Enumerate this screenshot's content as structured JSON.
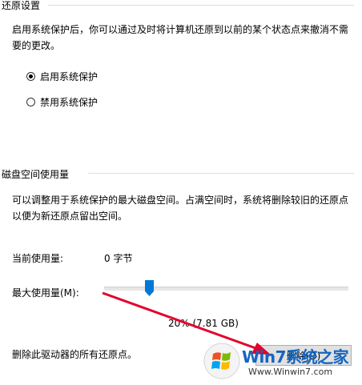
{
  "restore": {
    "title": "还原设置",
    "description": "启用系统保护后，你可以通过及时将计算机还原到以前的某个状态点来撤消不需要的更改。",
    "options": [
      {
        "label": "启用系统保护",
        "selected": true
      },
      {
        "label": "禁用系统保护",
        "selected": false
      }
    ]
  },
  "disk": {
    "title": "磁盘空间使用量",
    "description": "可以调整用于系统保护的最大磁盘空间。占满空间时，系统将删除较旧的还原点以便为新还原点留出空间。",
    "current_usage_label": "当前使用量:",
    "current_usage_value": "0 字节",
    "max_usage_label": "最大使用量(M):",
    "max_usage_fraction": 0.2,
    "max_usage_readout": "20% (7.81 GB)",
    "delete_text": "删除此驱动器的所有还原点。",
    "delete_button": "删除(D)"
  },
  "watermark": {
    "brand": "Win7系统之家",
    "url": "Www.Winwin7.com"
  },
  "colors": {
    "thumb": "#0078d7",
    "arrow": "#e4002b",
    "rule": "#dcdcdc"
  }
}
